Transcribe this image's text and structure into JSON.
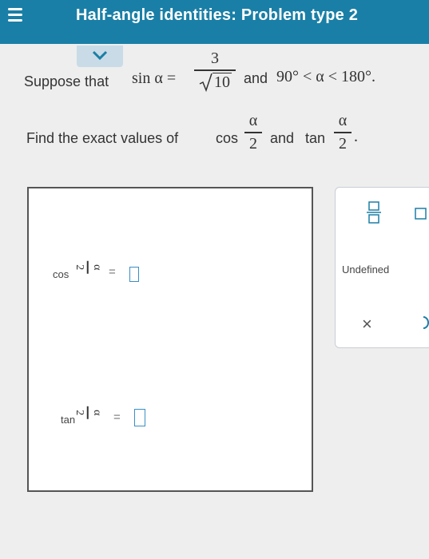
{
  "header": {
    "title": "Half-angle identities: Problem type 2"
  },
  "problem": {
    "suppose": "Suppose that",
    "sin_alpha": "sin α =",
    "numerator": "3",
    "denominator": "10",
    "and": "and",
    "condition": "90° < α < 180°.",
    "find": "Find the exact values of",
    "cos": "cos",
    "alpha": "α",
    "two": "2",
    "and2": "and",
    "tan": "tan",
    "period": "."
  },
  "answers": {
    "cos_label": "cos",
    "tan_label": "tan",
    "alpha": "α",
    "two": "2",
    "equals": "="
  },
  "keypad": {
    "undefined_label": "Undefined",
    "clear": "×"
  },
  "colors": {
    "header": "#1a7fa6",
    "accent": "#3a8ec4"
  }
}
